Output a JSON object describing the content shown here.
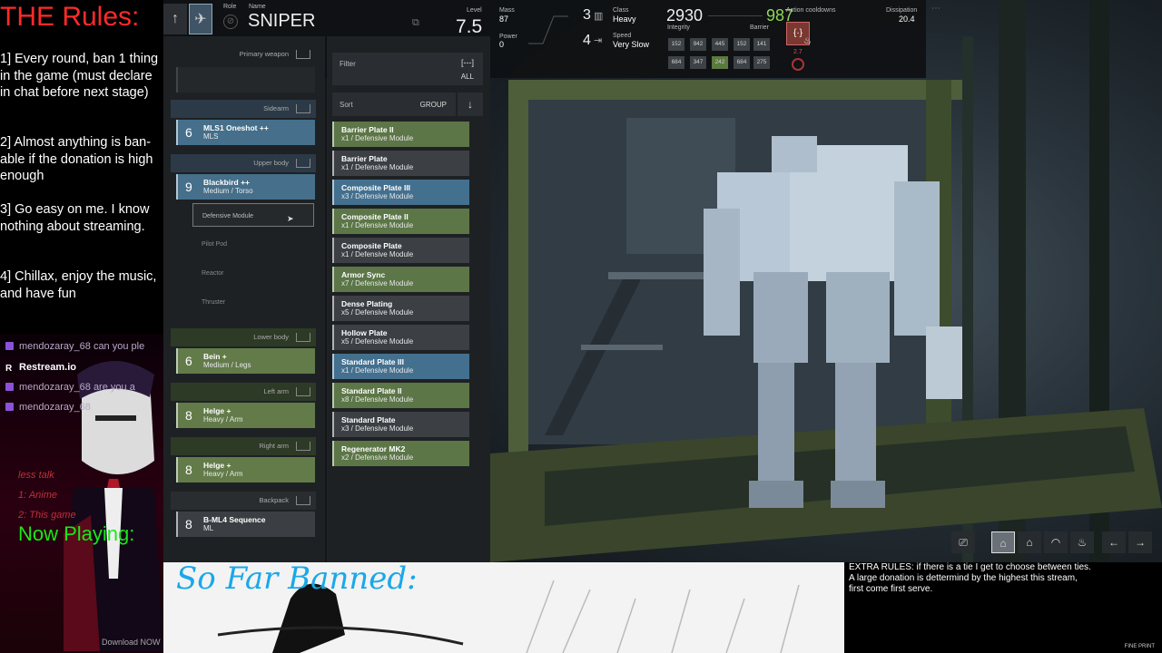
{
  "rules": {
    "title": "THE Rules:",
    "items": [
      "1]  Every round, ban 1 thing in the game (must declare in chat before next stage)",
      "2]  Almost anything is ban-able if the donation is high enough",
      "3]  Go easy on me. I know nothing about streaming.",
      "4] Chillax, enjoy the music, and have fun"
    ]
  },
  "chat": [
    {
      "icon": "twitch",
      "text": "mendozaray_68  can you ple"
    },
    {
      "icon": "restream",
      "text": "Restream.io"
    },
    {
      "icon": "twitch",
      "text": "mendozaray_68  are you a"
    },
    {
      "icon": "twitch",
      "text": "mendozaray_68"
    }
  ],
  "overlay": {
    "notes": [
      "less talk",
      "1: Anime",
      "2: This game"
    ],
    "now_playing": "Now Playing:",
    "download": "Download NOW"
  },
  "header": {
    "role_label": "Role",
    "name_label": "Name",
    "name": "SNIPER",
    "level_label": "Level",
    "level": "7.5",
    "mass_label": "Mass",
    "mass": "87",
    "power_label": "Power",
    "power": "0",
    "class_count": "3",
    "class_label": "Class",
    "class_value": "Heavy",
    "speed_count": "4",
    "speed_label": "Speed",
    "speed_value": "Very Slow",
    "integrity": "2930",
    "integrity_label": "Integrity",
    "barrier": "987",
    "barrier_label": "Barrier",
    "integrity_stats": [
      "152",
      "942",
      "445",
      "152",
      "684",
      "347",
      "242",
      "684"
    ],
    "barrier_stats": [
      "141",
      "275"
    ],
    "cooldowns_label": "Action cooldowns",
    "cooldown_value": "2.7",
    "dissipation_label": "Dissipation",
    "dissipation": "20.4"
  },
  "slots": {
    "primary": "Primary weapon",
    "sidearm": "Sidearm",
    "sidearm_item": {
      "level": "6",
      "name": "MLS1 Oneshot ++",
      "sub": "MLS"
    },
    "upper": "Upper body",
    "upper_item": {
      "level": "9",
      "name": "Blackbird ++",
      "sub": "Medium / Torso"
    },
    "sub_modules": [
      "Defensive Module",
      "Pilot Pod",
      "Reactor",
      "Thruster"
    ],
    "lower": "Lower body",
    "lower_item": {
      "level": "6",
      "name": "Bein +",
      "sub": "Medium / Legs"
    },
    "left_arm": "Left arm",
    "left_item": {
      "level": "8",
      "name": "Helge +",
      "sub": "Heavy / Arm"
    },
    "right_arm": "Right arm",
    "right_item": {
      "level": "8",
      "name": "Helge +",
      "sub": "Heavy / Arm"
    },
    "backpack": "Backpack",
    "backpack_item": {
      "level": "8",
      "name": "B-ML4 Sequence",
      "sub": "ML"
    }
  },
  "list": {
    "filter_label": "Filter",
    "filter_value": "ALL",
    "filter_icon": "[---]",
    "sort_label": "Sort",
    "sort_value": "GROUP",
    "items": [
      {
        "name": "Barrier Plate II",
        "sub": "x1 / Defensive Module",
        "color": "green"
      },
      {
        "name": "Barrier Plate",
        "sub": "x1 / Defensive Module",
        "color": "gray"
      },
      {
        "name": "Composite Plate III",
        "sub": "x3 / Defensive Module",
        "color": "blue"
      },
      {
        "name": "Composite Plate II",
        "sub": "x1 / Defensive Module",
        "color": "green"
      },
      {
        "name": "Composite Plate",
        "sub": "x1 / Defensive Module",
        "color": "gray"
      },
      {
        "name": "Armor Sync",
        "sub": "x7 / Defensive Module",
        "color": "green"
      },
      {
        "name": "Dense Plating",
        "sub": "x5 / Defensive Module",
        "color": "gray"
      },
      {
        "name": "Hollow Plate",
        "sub": "x5 / Defensive Module",
        "color": "gray"
      },
      {
        "name": "Standard Plate III",
        "sub": "x1 / Defensive Module",
        "color": "blue"
      },
      {
        "name": "Standard Plate II",
        "sub": "x8 / Defensive Module",
        "color": "green"
      },
      {
        "name": "Standard Plate",
        "sub": "x3 / Defensive Module",
        "color": "gray"
      },
      {
        "name": "Regenerator MK2",
        "sub": "x2 / Defensive Module",
        "color": "green"
      }
    ]
  },
  "bottom": {
    "banned_title": "So Far Banned:",
    "extra_rules": [
      "EXTRA RULES:   if there is a tie I get to choose between ties.",
      "A large donation is dettermind by the highest this stream,",
      "first come first serve."
    ],
    "fine_print": "FINE PRINT"
  }
}
